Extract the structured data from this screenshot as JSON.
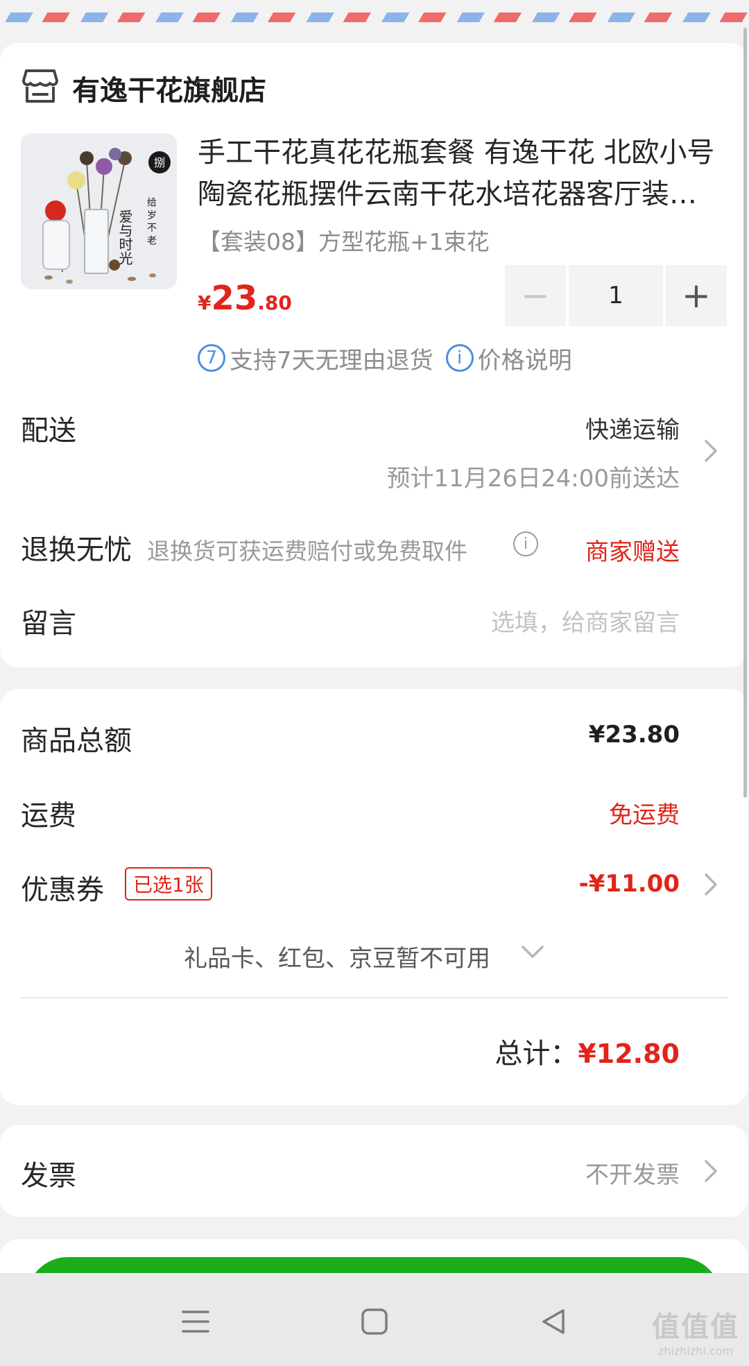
{
  "store": {
    "name": "有逸干花旗舰店",
    "icon": "store-icon"
  },
  "product": {
    "title": "手工干花真花花瓶套餐 有逸干花 北欧小号陶瓷花瓶摆件云南干花水培花器客厅装饰插花",
    "spec": "【套装08】方型花瓶+1束花",
    "price_currency": "¥",
    "price_int": "23",
    "price_dec": ".80",
    "quantity": "1",
    "minus_label": "−",
    "plus_label": "+",
    "image_text": {
      "seal": "捌",
      "line1": "爱与时光",
      "line2": "给 岁 不 老"
    }
  },
  "services": {
    "return_badge": "7",
    "return_text": "支持7天无理由退货",
    "price_info_badge": "i",
    "price_info_text": "价格说明"
  },
  "delivery": {
    "label": "配送",
    "method": "快递运输",
    "eta": "预计11月26日24:00前送达"
  },
  "returns": {
    "label": "退换无忧",
    "desc": "退换货可获运费赔付或免费取件",
    "info_badge": "i",
    "value": "商家赠送"
  },
  "message": {
    "label": "留言",
    "placeholder": "选填，给商家留言"
  },
  "summary": {
    "goods_label": "商品总额",
    "goods_value": "¥23.80",
    "shipping_label": "运费",
    "shipping_value": "免运费",
    "coupon_label": "优惠券",
    "coupon_badge": "已选1张",
    "coupon_value": "-¥11.00",
    "unavailable": "礼品卡、红包、京豆暂不可用",
    "total_label": "总计：",
    "total_value": "¥12.80"
  },
  "invoice": {
    "label": "发票",
    "value": "不开发票"
  },
  "watermark": {
    "big": "值值值",
    "small": "zhizhizhi.com"
  },
  "colors": {
    "accent_red": "#e2231a",
    "info_blue": "#4a8fe0",
    "submit_green": "#1aad19"
  }
}
